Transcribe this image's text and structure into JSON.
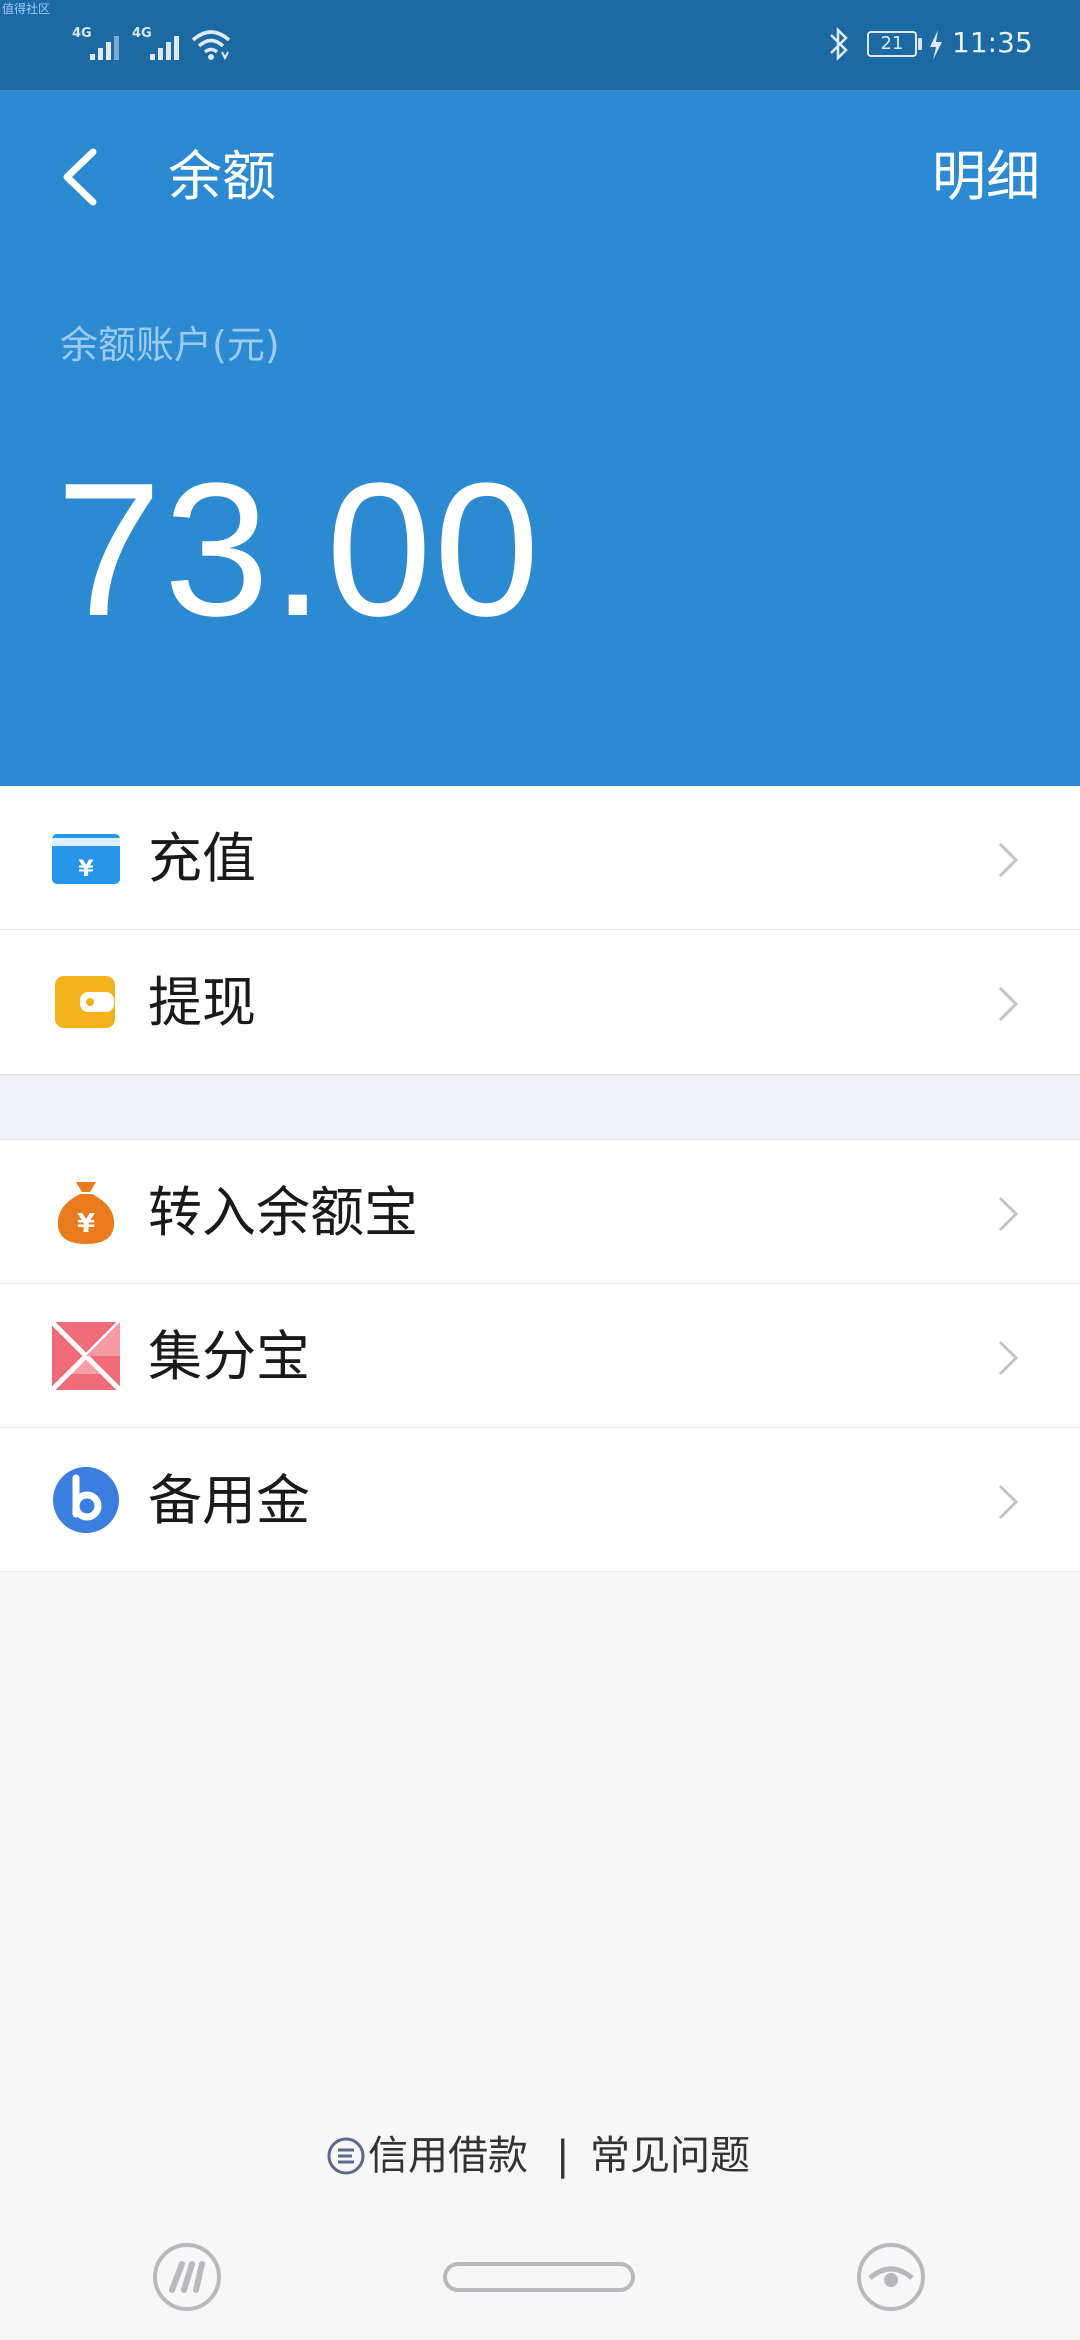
{
  "status_bar": {
    "watermark": "值得社区",
    "signal1_label": "4G",
    "signal2_label": "4G",
    "battery_level": "21",
    "time": "11:35"
  },
  "header": {
    "title": "余额",
    "detail_link": "明细",
    "account_label": "余额账户(元)",
    "balance": "73.00",
    "background_color": "#2b8ad1"
  },
  "menu_group_1": [
    {
      "label": "充值",
      "icon": "recharge-card-icon",
      "icon_color": "#2796e8"
    },
    {
      "label": "提现",
      "icon": "wallet-icon",
      "icon_color": "#f3b21b"
    }
  ],
  "menu_group_2": [
    {
      "label": "转入余额宝",
      "icon": "money-bag-icon",
      "icon_color": "#ea7a1e"
    },
    {
      "label": "集分宝",
      "icon": "points-icon",
      "icon_color": "#f06c78"
    },
    {
      "label": "备用金",
      "icon": "reserve-fund-icon",
      "icon_color": "#3b7ee0"
    }
  ],
  "footer": {
    "credit_link": "信用借款",
    "separator": "|",
    "faq_link": "常见问题"
  }
}
